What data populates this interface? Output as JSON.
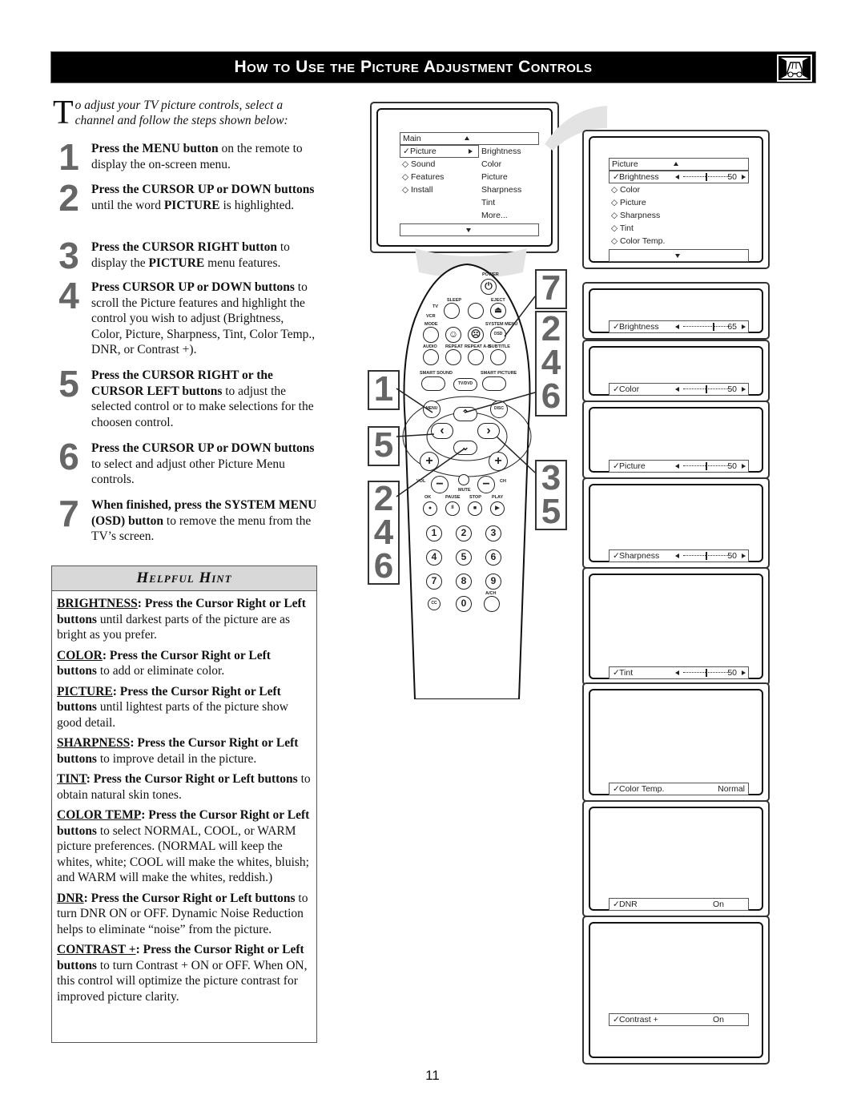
{
  "header": {
    "title": "How to Use the Picture Adjustment Controls",
    "icon": "tv-car-icon"
  },
  "intro": {
    "dropcap": "T",
    "text": "o adjust your TV picture controls, select a channel and follow the steps shown below:"
  },
  "steps": [
    {
      "num": "1",
      "bold": "Press the MENU button",
      "rest": " on the remote to display the on-screen menu."
    },
    {
      "num": "2",
      "bold": "Press the CURSOR UP or DOWN buttons",
      "rest": " until the word ",
      "bold2": "PICTURE",
      "rest2": " is highlighted."
    },
    {
      "num": "3",
      "bold": "Press the CURSOR RIGHT button",
      "rest": " to display the ",
      "bold2": "PICTURE",
      "rest2": " menu features."
    },
    {
      "num": "4",
      "bold": "Press CURSOR UP or DOWN buttons",
      "rest": " to scroll the Picture features and highlight the control you wish to adjust (Brightness, Color, Picture, Sharpness, Tint, Color Temp., DNR, or Contrast +)."
    },
    {
      "num": "5",
      "bold": "Press the CURSOR RIGHT or the CURSOR LEFT buttons",
      "rest": " to adjust the selected control or to make selections for the choosen control."
    },
    {
      "num": "6",
      "bold": "Press the CURSOR UP or DOWN buttons",
      "rest": " to select and adjust other Picture Menu controls."
    },
    {
      "num": "7",
      "bold": "When finished, press the SYSTEM MENU (OSD) button",
      "rest": " to remove the menu from the TV’s screen."
    }
  ],
  "hint": {
    "title": "Helpful Hint",
    "items": [
      {
        "term": "BRIGHTNESS",
        "bold": ":  Press the Cursor Right or Left buttons",
        "rest": " until darkest parts of the picture are as bright as you prefer."
      },
      {
        "term": "COLOR",
        "bold": ":  Press the Cursor Right or Left buttons",
        "rest": " to add or eliminate color."
      },
      {
        "term": "PICTURE",
        "bold": ":  Press the Cursor Right or Left buttons",
        "rest": " until lightest parts of the picture show good detail."
      },
      {
        "term": "SHARPNESS",
        "bold": ":  Press the Cursor Right or Left buttons",
        "rest": " to improve detail in the picture."
      },
      {
        "term": "TINT",
        "bold": ":  Press the Cursor Right or Left buttons",
        "rest": " to obtain natural skin tones."
      },
      {
        "term": "COLOR TEMP",
        "bold": ": Press the Cursor Right or Left buttons",
        "rest": " to select NORMAL, COOL, or WARM picture preferences. (NORMAL will keep the whites, white; COOL will make the whites, bluish; and WARM will make the whites, reddish.)"
      },
      {
        "term": "DNR",
        "bold": ": Press the Cursor Right or Left buttons",
        "rest": " to turn DNR ON or OFF. Dynamic Noise Reduction helps to eliminate “noise” from the picture."
      },
      {
        "term": "CONTRAST +",
        "bold": ": Press the Cursor Right or Left buttons",
        "rest": " to turn Contrast + ON or OFF. When ON, this control will optimize the picture contrast for  improved picture clarity."
      }
    ]
  },
  "main_menu": {
    "header": "Main",
    "items": [
      "Picture",
      "Sound",
      "Features",
      "Install"
    ],
    "selected": "Picture",
    "submenu": [
      "Brightness",
      "Color",
      "Picture",
      "Sharpness",
      "Tint",
      "More..."
    ]
  },
  "picture_menu": {
    "header": "Picture",
    "selected": "Brightness",
    "selected_value": "50",
    "selected_level": 50,
    "items": [
      "Color",
      "Picture",
      "Sharpness",
      "Tint",
      "Color Temp."
    ]
  },
  "adjust_screens": [
    {
      "label": "Brightness",
      "value": "65",
      "level": 65,
      "type": "slider"
    },
    {
      "label": "Color",
      "value": "50",
      "level": 50,
      "type": "slider"
    },
    {
      "label": "Picture",
      "value": "50",
      "level": 50,
      "type": "slider"
    },
    {
      "label": "Sharpness",
      "value": "50",
      "level": 50,
      "type": "slider"
    },
    {
      "label": "Tint",
      "value": "50",
      "level": 50,
      "type": "slider"
    },
    {
      "label": "Color Temp.",
      "value": "Normal",
      "type": "option"
    },
    {
      "label": "DNR",
      "value": "On",
      "type": "option"
    },
    {
      "label": "Contrast +",
      "value": "On",
      "type": "option"
    }
  ],
  "remote": {
    "labels": {
      "power": "POWER",
      "sleep": "SLEEP",
      "eject": "EJECT",
      "tv": "TV",
      "vcr": "VCR",
      "mode": "MODE",
      "system_menu": "SYSTEM MENU",
      "osd": "OSD",
      "audio": "AUDIO",
      "repeat": "REPEAT",
      "repeat_ab": "REPEAT A-B",
      "subtitle": "SUBTITLE",
      "smart_sound": "SMART SOUND",
      "smart_picture": "SMART PICTURE",
      "tvdvd": "TV/DVD",
      "menu": "MENU",
      "disc": "DISC",
      "vol": "VOL",
      "ch": "CH",
      "mute": "MUTE",
      "ok": "OK",
      "pause": "PAUSE",
      "stop": "STOP",
      "play": "PLAY",
      "cc": "CC",
      "ach": "A/CH"
    },
    "digits": [
      "1",
      "2",
      "3",
      "4",
      "5",
      "6",
      "7",
      "8",
      "9",
      "0"
    ]
  },
  "callouts": {
    "left_1": "1",
    "left_5": "5",
    "left_246": [
      "2",
      "4",
      "6"
    ],
    "right_7": "7",
    "right_246": [
      "2",
      "4",
      "6"
    ],
    "right_35": [
      "3",
      "5"
    ]
  },
  "page_number": "11"
}
